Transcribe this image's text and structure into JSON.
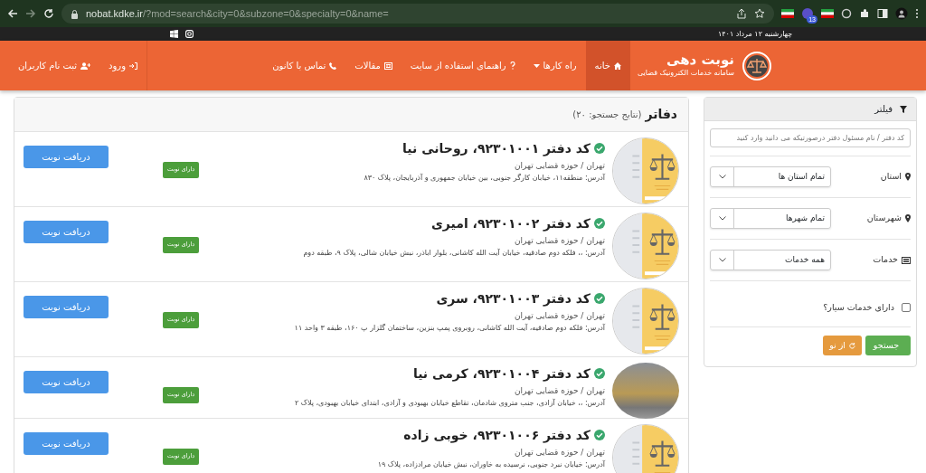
{
  "browser": {
    "url": "nobat.kdke.ir/?mod=search&city=0&subzone=0&specialty=0&name=",
    "extension_count": "13"
  },
  "topbar": {
    "date": "چهارشنبه ۱۲ مرداد ۱۴۰۱"
  },
  "navbar": {
    "brand_title": "نوبت دهی",
    "brand_subtitle": "سامانه خدمات الکترونیک قضایی",
    "items": [
      {
        "label": "خانه",
        "kind": "home",
        "selected": true
      },
      {
        "label": "راه کارها",
        "kind": "menu",
        "selected": false
      },
      {
        "label": "راهنمای استفاده از سایت",
        "kind": "guide",
        "selected": false
      },
      {
        "label": "مقالات",
        "kind": "articles",
        "selected": false
      },
      {
        "label": "تماس با کانون",
        "kind": "contact",
        "selected": false
      }
    ],
    "user_links": [
      {
        "label": "ورود",
        "kind": "login"
      },
      {
        "label": "ثبت نام کاربران",
        "kind": "register"
      }
    ]
  },
  "filter": {
    "title": "فیلتر",
    "search": {
      "placeholder": "کد دفتر / نام مسئول دفتر درصورتیکه می دانید وارد کنید"
    },
    "fields": [
      {
        "label": "استان",
        "kind": "location",
        "value": "تمام استان ها"
      },
      {
        "label": "شهرستان",
        "kind": "location",
        "value": "تمام شهرها"
      },
      {
        "label": "خدمات",
        "kind": "services",
        "value": "همه خدمات"
      }
    ],
    "checkbox": {
      "label": "دارای خدمات سیار؟",
      "checked": false
    },
    "buttons": [
      {
        "label": "جستجو",
        "kind": "search"
      },
      {
        "label": "از نو",
        "kind": "reset"
      }
    ]
  },
  "results": {
    "title": "دفاتر",
    "count": "(نتایج جستجو: ۲۰)",
    "offices": [
      {
        "title": "کد دفتر ۹۲۳۰۱۰۰۱، روحانی نیا",
        "verified": true,
        "kind": "logo",
        "region": "تهران / حوزه قضایی تهران",
        "address": "آدرس: منطقه۱۱، خیابان کارگر جنوبی، بین خیابان جمهوری و آذربایجان، پلاک ۸۳۰",
        "badge": "دارای نوبت",
        "button": "دریافت نوبت"
      },
      {
        "title": "کد دفتر ۹۲۳۰۱۰۰۲، امیری",
        "verified": true,
        "kind": "logo",
        "region": "تهران / حوزه قضایی تهران",
        "address": "آدرس: ،، فلکه دوم صادقیه، خیابان آیت الله کاشانی، بلوار اباذر، نبش خیابان شالی، پلاک ۹، طبقه دوم",
        "badge": "دارای نوبت",
        "button": "دریافت نوبت"
      },
      {
        "title": "کد دفتر ۹۲۳۰۱۰۰۳، سری",
        "verified": true,
        "kind": "logo",
        "region": "تهران / حوزه قضایی تهران",
        "address": "آدرس: فلکه دوم صادقیه، آیت الله کاشانی، روبروی پمپ بنزین، ساختمان گلزار پ ۱۶۰، طبقه ۳ واحد ۱۱",
        "badge": "دارای نوبت",
        "button": "دریافت نوبت"
      },
      {
        "title": "کد دفتر ۹۲۳۰۱۰۰۴، کرمی نیا",
        "verified": true,
        "kind": "photo",
        "region": "تهران / حوزه قضایی تهران",
        "address": "آدرس: ،، خیابان آزادی، جنب متروی شادمان، تقاطع خیابان بهبودی و آزادی، ابتدای خیابان بهبودی، پلاک ۲",
        "badge": "دارای نوبت",
        "button": "دریافت نوبت"
      },
      {
        "title": "کد دفتر ۹۲۳۰۱۰۰۶، خوبی زاده",
        "verified": true,
        "kind": "logo",
        "region": "تهران / حوزه قضایی تهران",
        "address": "آدرس: خیابان نبرد جنوبی، نرسیده به خاوران، نبش خیابان مرادزاده، پلاک ۱۹",
        "badge": "دارای نوبت",
        "button": "دریافت نوبت"
      }
    ]
  }
}
